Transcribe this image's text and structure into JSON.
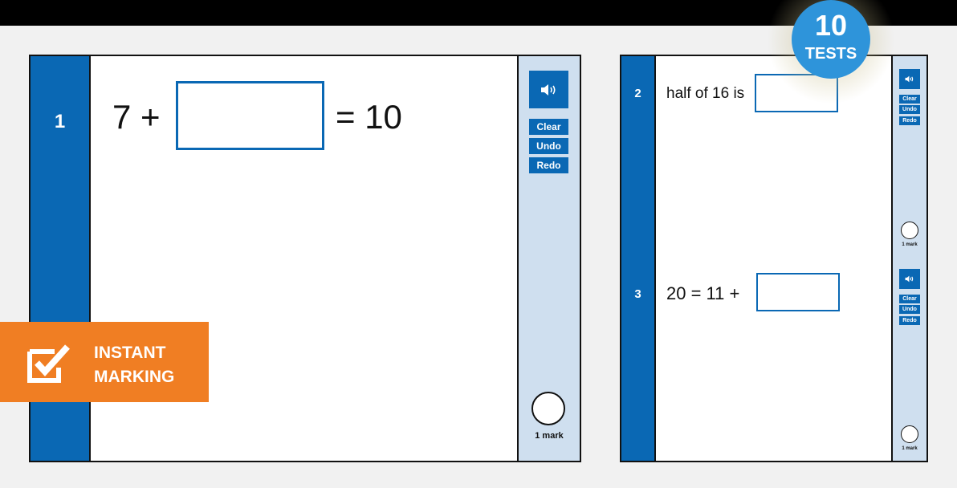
{
  "badges": {
    "tests_count": "10",
    "tests_label": "TESTS",
    "instant_line1": "INSTANT",
    "instant_line2": "MARKING"
  },
  "colors": {
    "primary_blue": "#0a68b4",
    "side_panel": "#cfdfef",
    "orange": "#f07e23",
    "badge_blue": "#2e94da"
  },
  "tools": {
    "audio_icon": "speaker-icon",
    "clear": "Clear",
    "undo": "Undo",
    "redo": "Redo",
    "mark": "1 mark"
  },
  "questions": [
    {
      "number": "1",
      "before": "7 +",
      "answer": "",
      "after": "= 10",
      "marks": "1 mark"
    },
    {
      "number": "2",
      "before": "half of 16 is",
      "answer": "",
      "after": "",
      "marks": "1 mark"
    },
    {
      "number": "3",
      "before": "20 = 11 +",
      "answer": "",
      "after": "",
      "marks": "1 mark"
    }
  ]
}
